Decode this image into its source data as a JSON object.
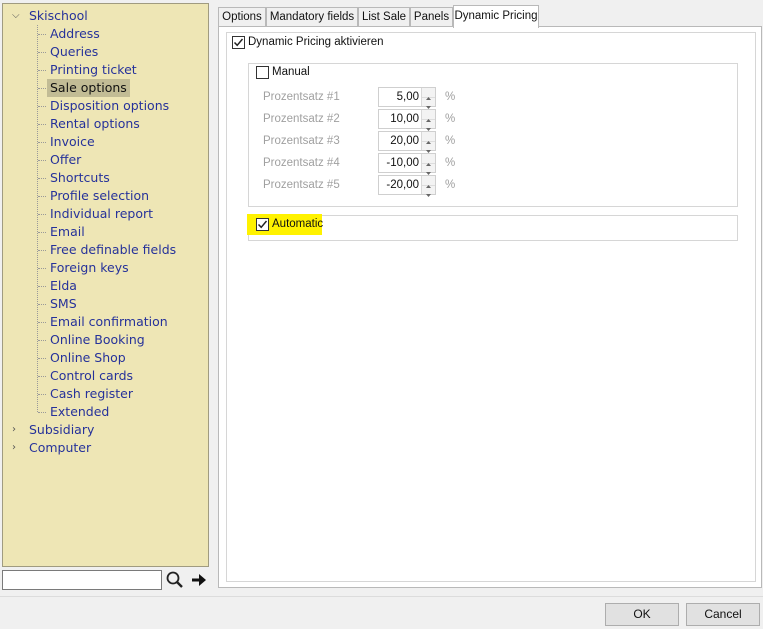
{
  "tree": {
    "root_label": "Skischool",
    "selected_index": 3,
    "children": [
      "Address",
      "Queries",
      "Printing ticket",
      "Sale options",
      "Disposition options",
      "Rental options",
      "Invoice",
      "Offer",
      "Shortcuts",
      "Profile selection",
      "Individual report",
      "Email",
      "Free definable fields",
      "Foreign keys",
      "Elda",
      "SMS",
      "Email confirmation",
      "Online Booking",
      "Online Shop",
      "Control cards",
      "Cash register",
      "Extended"
    ],
    "collapsed_roots": [
      "Subsidiary",
      "Computer"
    ]
  },
  "search": {
    "value": "",
    "search_icon": "magnifier-icon",
    "go_icon": "arrow-right-icon"
  },
  "tabs": [
    {
      "label": "Options"
    },
    {
      "label": "Mandatory fields"
    },
    {
      "label": "List Sale"
    },
    {
      "label": "Panels"
    },
    {
      "label": "Dynamic Pricing",
      "active": true
    }
  ],
  "dynamic_pricing": {
    "activate_label": "Dynamic Pricing aktivieren",
    "activate_checked": true,
    "manual_label": "Manual",
    "manual_checked": false,
    "rows": [
      {
        "label": "Prozentsatz #1",
        "value": "5,00",
        "unit": "%"
      },
      {
        "label": "Prozentsatz #2",
        "value": "10,00",
        "unit": "%"
      },
      {
        "label": "Prozentsatz #3",
        "value": "20,00",
        "unit": "%"
      },
      {
        "label": "Prozentsatz #4",
        "value": "-10,00",
        "unit": "%"
      },
      {
        "label": "Prozentsatz #5",
        "value": "-20,00",
        "unit": "%"
      }
    ],
    "automatic_label": "Automatic",
    "automatic_checked": true,
    "automatic_highlight_color": "#fff200"
  },
  "buttons": {
    "ok": "OK",
    "cancel": "Cancel"
  }
}
